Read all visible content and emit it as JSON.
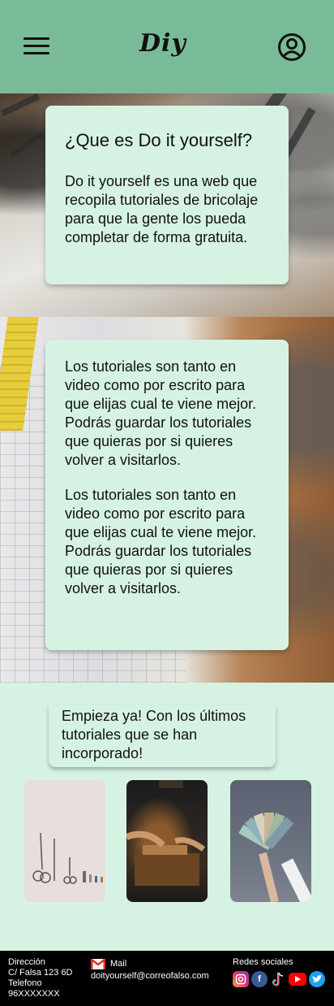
{
  "header": {
    "logo": "Diy"
  },
  "hero": {
    "card1": {
      "title": "¿Que es Do it yourself?",
      "text": "Do it yourself es una web que recopila tutoriales de bricolaje para que la gente los pueda completar de forma gratuita."
    },
    "card2": {
      "paragraphs": [
        "Los tutoriales son tanto en video como por escrito para que elijas cual te viene mejor. Podrás guardar los tutoriales que quieras por si quieres volver a visitarlos.",
        "Los tutoriales son tanto en video como por escrito para que elijas cual te viene mejor. Podrás guardar los tutoriales que quieras por si quieres volver a visitarlos."
      ]
    }
  },
  "start": {
    "text": "Empieza ya! Con los últimos tutoriales que se han incorporado!"
  },
  "footer": {
    "address_label": "Dirección",
    "address": "C/ Falsa 123 6D",
    "phone_label": "Telefono",
    "phone": "96XXXXXXX",
    "mail_label": "Mail",
    "mail": "doityourself@correofalso.com",
    "social_label": "Redes sociales",
    "social_icons": [
      "instagram-icon",
      "facebook-icon",
      "tiktok-icon",
      "youtube-icon",
      "twitter-icon"
    ]
  },
  "colors": {
    "header": "#79bb98",
    "background": "#d6f2e3",
    "footer": "#000000"
  }
}
